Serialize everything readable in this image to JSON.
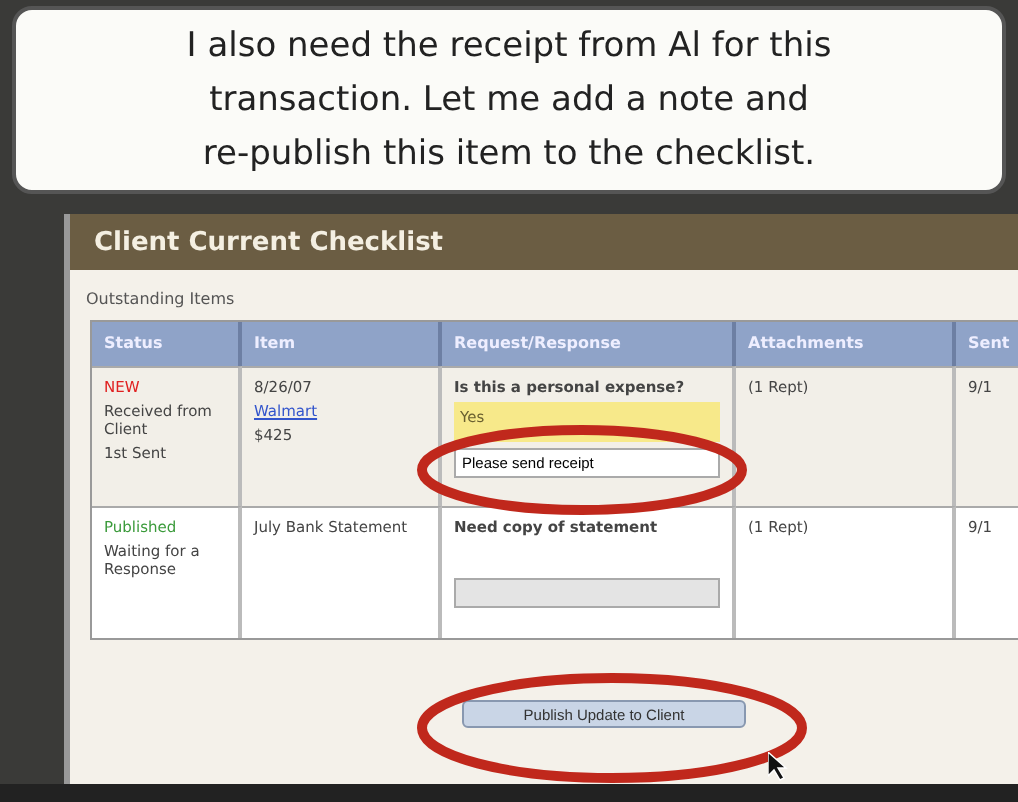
{
  "callout": {
    "lines": [
      "I also need the receipt from Al for this",
      "transaction. Let me add a note and",
      "re-publish this item to the checklist."
    ]
  },
  "panel": {
    "title": "Client Current Checklist",
    "subtitle": "Outstanding Items"
  },
  "table": {
    "columns": [
      "Status",
      "Item",
      "Request/Response",
      "Attachments",
      "Sent"
    ],
    "rows": [
      {
        "status_label": {
          "text": "NEW",
          "color": "#e02020"
        },
        "status_lines": [
          "Received from Client",
          "1st Sent"
        ],
        "item": [
          {
            "text": "8/26/07",
            "kind": "plain"
          },
          {
            "text": "Walmart",
            "kind": "link"
          },
          {
            "text": "$425",
            "kind": "plain"
          }
        ],
        "question": "Is this a personal expense?",
        "response": "Yes",
        "note_field": {
          "disabled": false,
          "value": "Please send receipt"
        },
        "attachments": "(1 Rept)",
        "sent": "9/1"
      },
      {
        "status_label": {
          "text": "Published",
          "color": "#3a9a3a"
        },
        "status_lines": [
          "Waiting for a Response"
        ],
        "item": [
          {
            "text": "July Bank Statement",
            "kind": "plain"
          }
        ],
        "question": "Need copy of statement",
        "note_field": {
          "disabled": true
        },
        "attachments": "(1 Rept)",
        "sent": "9/1"
      }
    ]
  },
  "publish_button": {
    "label": "Publish Update to Client"
  }
}
